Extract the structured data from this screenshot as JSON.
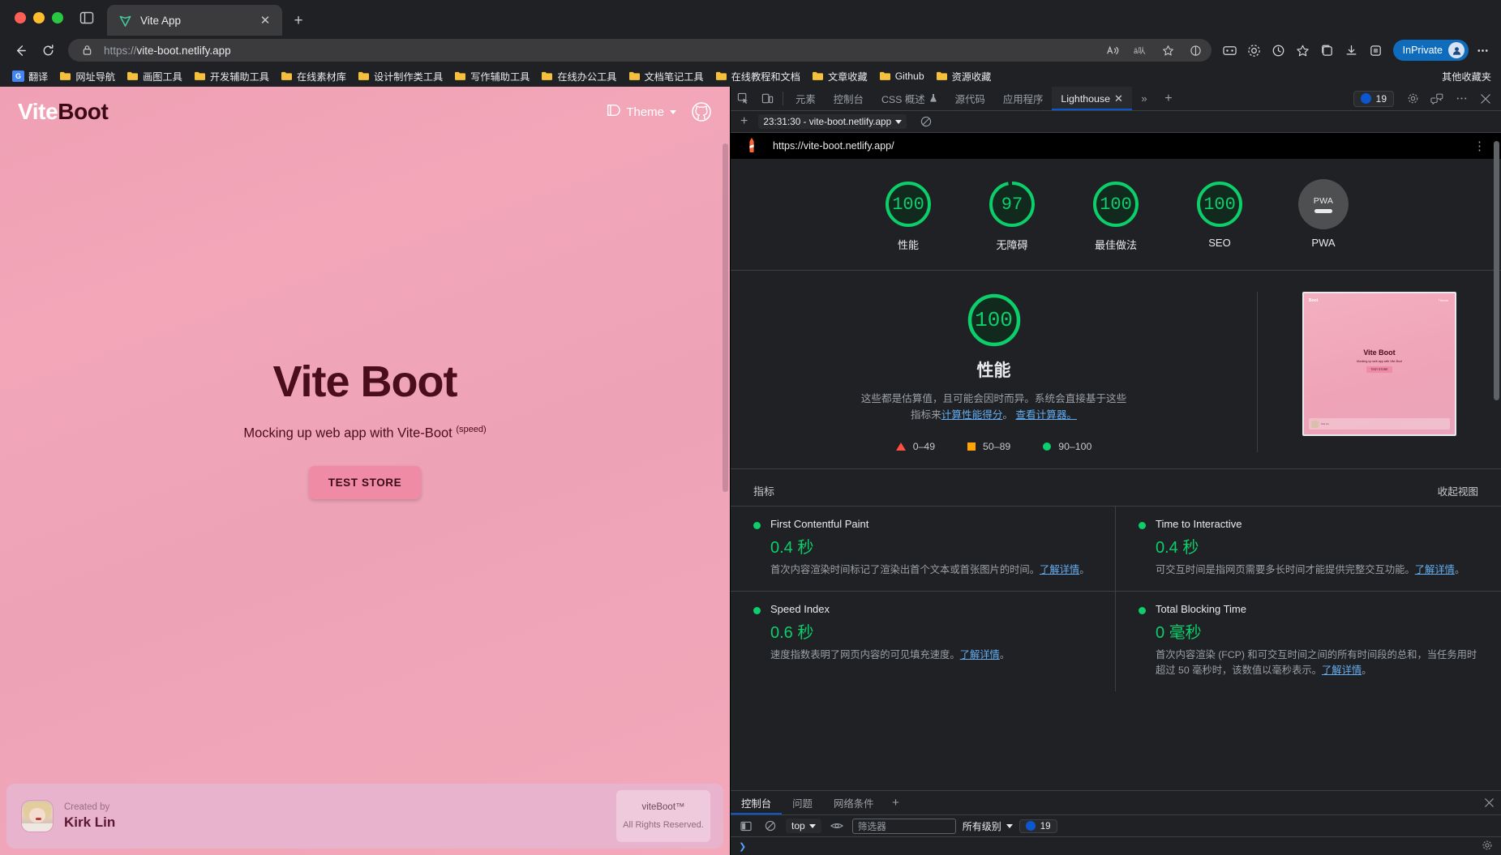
{
  "browser": {
    "tab": {
      "title": "Vite App",
      "favicon": "vite-logo-icon",
      "close": "✕"
    },
    "newtab_label": "+",
    "omnibox": {
      "scheme": "https://",
      "host": "vite-boot.netlify.app",
      "lock": "lock-icon"
    },
    "profile": {
      "label": "InPrivate"
    },
    "bookmarks": [
      {
        "label": "翻译",
        "icon": "google-translate-icon"
      },
      {
        "label": "网址导航",
        "icon": "folder-icon"
      },
      {
        "label": "画图工具",
        "icon": "folder-icon"
      },
      {
        "label": "开发辅助工具",
        "icon": "folder-icon"
      },
      {
        "label": "在线素材库",
        "icon": "folder-icon"
      },
      {
        "label": "设计制作类工具",
        "icon": "folder-icon"
      },
      {
        "label": "写作辅助工具",
        "icon": "folder-icon"
      },
      {
        "label": "在线办公工具",
        "icon": "folder-icon"
      },
      {
        "label": "文档笔记工具",
        "icon": "folder-icon"
      },
      {
        "label": "在线教程和文档",
        "icon": "folder-icon"
      },
      {
        "label": "文章收藏",
        "icon": "folder-icon"
      },
      {
        "label": "Github",
        "icon": "folder-icon"
      },
      {
        "label": "资源收藏",
        "icon": "folder-icon"
      }
    ],
    "bookmarks_overflow": "其他收藏夹"
  },
  "page": {
    "brand_part1": "Vite",
    "brand_part2": "Boot",
    "theme_label": "Theme",
    "hero_title": "Vite Boot",
    "hero_subtitle": "Mocking up web app with Vite-Boot",
    "hero_sup": "(speed)",
    "cta_label": "TEST STORE",
    "footer_created_by": "Created by",
    "footer_author": "Kirk Lin",
    "footer_box_title": "viteBoot™",
    "footer_box_sub": "All Rights Reserved."
  },
  "devtools": {
    "tabs": [
      {
        "label": "元素",
        "active": false
      },
      {
        "label": "控制台",
        "active": false
      },
      {
        "label": "CSS 概述",
        "active": false,
        "flask": true
      },
      {
        "label": "源代码",
        "active": false
      },
      {
        "label": "应用程序",
        "active": false
      },
      {
        "label": "Lighthouse",
        "active": true,
        "closable": true
      }
    ],
    "more_label": "»",
    "add_tab_label": "+",
    "issues_count": "19",
    "settings_icon": "gear-icon",
    "feedback_icon": "feedback-icon",
    "kebab_icon": "more-options-icon",
    "close_icon": "close-icon",
    "lighthouse_toolbar": {
      "add_label": "+",
      "run_selector": "23:31:30 - vite-boot.netlify.app",
      "clear_icon": "clear-icon"
    }
  },
  "lighthouse": {
    "url": "https://vite-boot.netlify.app/",
    "gauges": [
      {
        "label": "性能",
        "score": "100",
        "pct": 100,
        "color": "#0cce6b"
      },
      {
        "label": "无障碍",
        "score": "97",
        "pct": 97,
        "color": "#0cce6b"
      },
      {
        "label": "最佳做法",
        "score": "100",
        "pct": 100,
        "color": "#0cce6b"
      },
      {
        "label": "SEO",
        "score": "100",
        "pct": 100,
        "color": "#0cce6b"
      }
    ],
    "pwa": {
      "label": "PWA",
      "badge": "PWA"
    },
    "perf": {
      "score": "100",
      "title": "性能",
      "desc_pre": "这些都是估算值，且可能会因时而异。系统会直接基于这些指标来",
      "link1": "计算性能得分",
      "desc_mid": "。 ",
      "link2": "查看计算器。",
      "legend": [
        {
          "range": "0–49",
          "shape": "triangle",
          "color": "#ff4e42"
        },
        {
          "range": "50–89",
          "shape": "square",
          "color": "#ffa400"
        },
        {
          "range": "90–100",
          "shape": "circle",
          "color": "#0cce6b"
        }
      ]
    },
    "metrics_header": "指标",
    "metrics_toggle": "收起视图",
    "metrics": [
      {
        "name": "First Contentful Paint",
        "value": "0.4 秒",
        "desc_pre": "首次内容渲染时间标记了渲染出首个文本或首张图片的时间。",
        "link": "了解详情",
        "desc_post": "。"
      },
      {
        "name": "Time to Interactive",
        "value": "0.4 秒",
        "desc_pre": "可交互时间是指网页需要多长时间才能提供完整交互功能。",
        "link": "了解详情",
        "desc_post": "。"
      },
      {
        "name": "Speed Index",
        "value": "0.6 秒",
        "desc_pre": "速度指数表明了网页内容的可见填充速度。",
        "link": "了解详情",
        "desc_post": "。"
      },
      {
        "name": "Total Blocking Time",
        "value": "0 毫秒",
        "desc_pre": "首次内容渲染 (FCP) 和可交互时间之间的所有时间段的总和，当任务用时超过 50 毫秒时，该数值以毫秒表示。",
        "link": "了解详情",
        "desc_post": "。"
      }
    ],
    "thumbnail": {
      "brand": "Boot",
      "theme": "Theme",
      "title": "Vite Boot",
      "subtitle": "Mocking up web app with Vite-Boot",
      "button": "TEST STORE",
      "footer": "Kirk Lin"
    }
  },
  "console_drawer": {
    "tabs": [
      {
        "label": "控制台",
        "active": true
      },
      {
        "label": "问题",
        "active": false
      },
      {
        "label": "网络条件",
        "active": false
      }
    ],
    "add_label": "+",
    "context": "top",
    "filter_placeholder": "筛选器",
    "levels": "所有级别",
    "issue_count": "19"
  }
}
